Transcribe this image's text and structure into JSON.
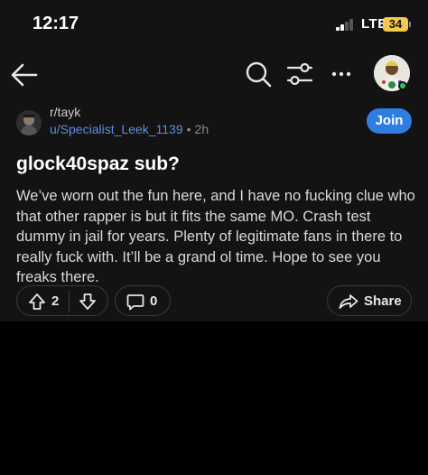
{
  "status": {
    "time": "12:17",
    "network": "LTE",
    "battery": "34"
  },
  "nav": {
    "back_icon": "arrow-left-icon",
    "search_icon": "search-icon",
    "filter_icon": "sliders-icon",
    "more_icon": "ellipsis-icon",
    "avatar_icon": "user-avatar",
    "online_color": "#2ec26b"
  },
  "post": {
    "subreddit": "r/tayk",
    "author": "u/Specialist_Leek_1139",
    "separator": "•",
    "age": "2h",
    "join_label": "Join",
    "title": "glock40spaz sub?",
    "body": "We’ve worn out the fun here, and I have no fucking clue who that other rapper is but it fits the same MO. Crash test dummy in jail for years. Plenty of legitimate fans in there to really fuck with. It’ll be a grand ol time. Hope to see you freaks there.",
    "upvote_count": "2",
    "comment_count": "0",
    "share_label": "Share"
  },
  "colors": {
    "accent": "#2f7de1",
    "author_link": "#5a8fe0",
    "background": "#131313"
  }
}
